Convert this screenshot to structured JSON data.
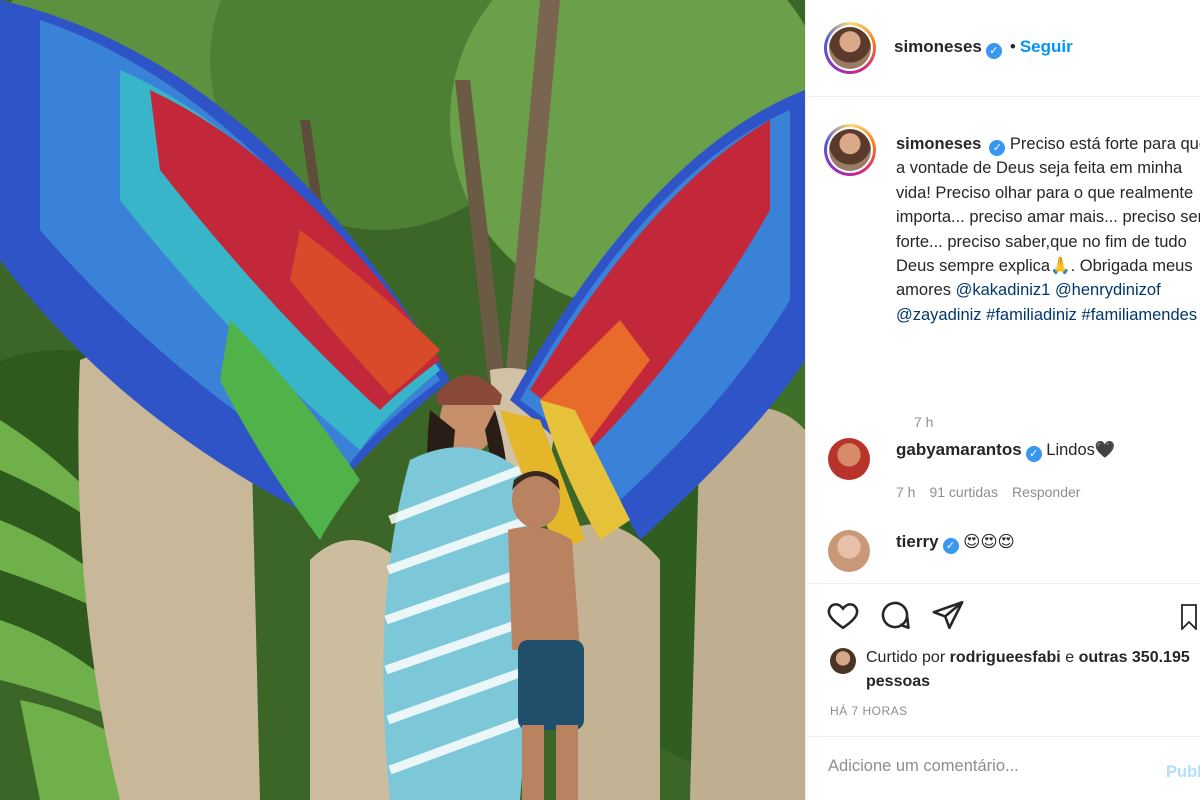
{
  "post": {
    "username": "simoneses",
    "follow_label": "Seguir",
    "caption_text": "Preciso está forte para que a vontade de Deus seja feita em minha vida! Preciso olhar para o que realmente importa... preciso amar mais... preciso ser forte... preciso saber,que no fim de tudo Deus sempre explica🙏. Obrigada meus amores",
    "caption_mentions": [
      "@kakadiniz1",
      "@henrydinizof",
      "@zayadiniz",
      "#familiadiniz",
      "#familiamendes"
    ],
    "caption_time": "7 h"
  },
  "comments": [
    {
      "username": "gabyamarantos",
      "text": "Lindos🖤",
      "time": "7 h",
      "likes": "91 curtidas",
      "reply": "Responder"
    },
    {
      "username": "tierry",
      "text": "😍😍😍",
      "time": "",
      "likes": "",
      "reply": ""
    }
  ],
  "likes": {
    "prefix": "Curtido por",
    "user": "rodrigueesfabi",
    "connector": "e",
    "others": "outras 350.195 pessoas"
  },
  "posted_ago": "HÁ 7 HORAS",
  "comment_box": {
    "placeholder": "Adicione um comentário...",
    "publish_label": "Publicar"
  },
  "icons": [
    "heart-icon",
    "comment-icon",
    "share-icon",
    "bookmark-icon",
    "verified-icon"
  ],
  "colors": {
    "link": "#0095f6",
    "mention": "#00376b",
    "verified": "#3897f0",
    "muted": "#8e8e8e"
  }
}
